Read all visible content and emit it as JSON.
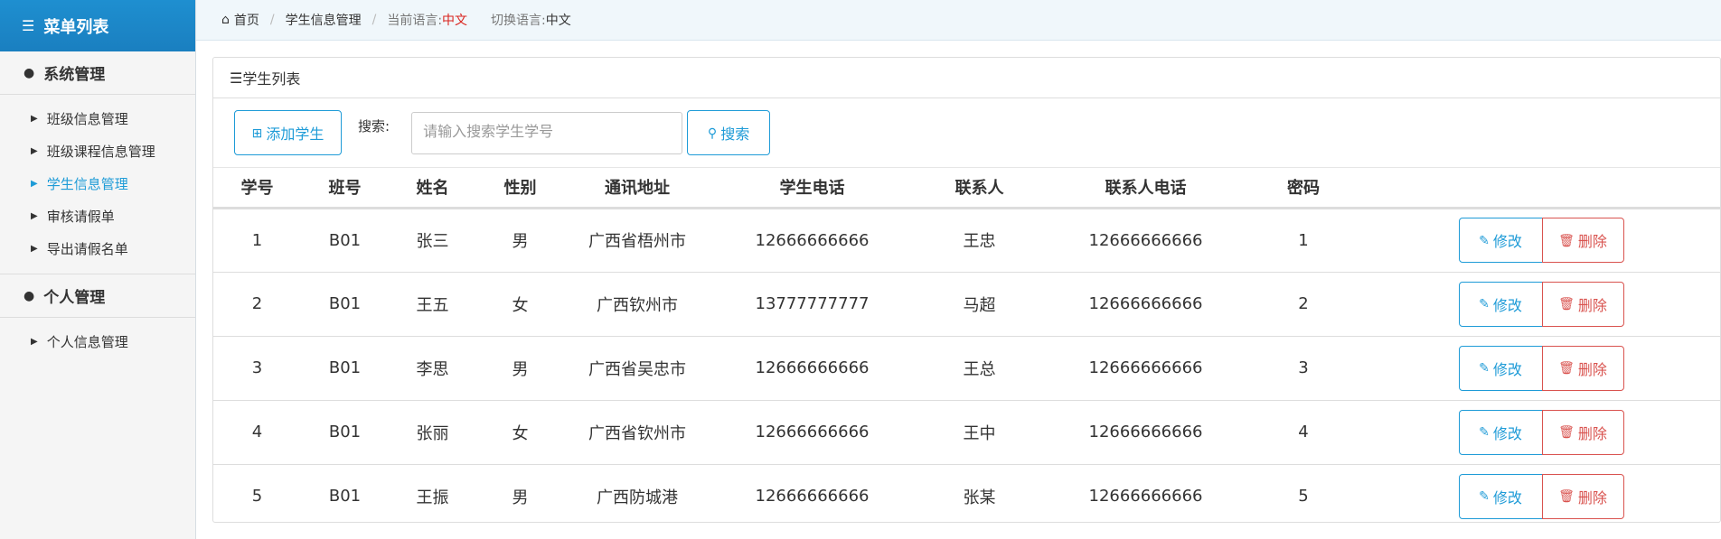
{
  "sidebar": {
    "title": "菜单列表",
    "groups": [
      {
        "title": "系统管理",
        "items": [
          "班级信息管理",
          "班级课程信息管理",
          "学生信息管理",
          "审核请假单",
          "导出请假名单"
        ]
      },
      {
        "title": "个人管理",
        "items": [
          "个人信息管理"
        ]
      }
    ],
    "active_item": "学生信息管理"
  },
  "breadcrumb": {
    "home": "首页",
    "current": "学生信息管理",
    "lang_label": "当前语言:",
    "lang_value": "中文",
    "switch_label": "切换语言:",
    "switch_value": "中文"
  },
  "panel": {
    "title": "学生列表",
    "add_button": "添加学生",
    "search_label": "搜索:",
    "search_placeholder": "请输入搜索学生学号",
    "search_button": "搜索"
  },
  "table": {
    "headers": [
      "学号",
      "班号",
      "姓名",
      "性别",
      "通讯地址",
      "学生电话",
      "联系人",
      "联系人电话",
      "密码"
    ],
    "rows": [
      [
        "1",
        "B01",
        "张三",
        "男",
        "广西省梧州市",
        "12666666666",
        "王忠",
        "12666666666",
        "1"
      ],
      [
        "2",
        "B01",
        "王五",
        "女",
        "广西钦州市",
        "13777777777",
        "马超",
        "12666666666",
        "2"
      ],
      [
        "3",
        "B01",
        "李思",
        "男",
        "广西省吴忠市",
        "12666666666",
        "王总",
        "12666666666",
        "3"
      ],
      [
        "4",
        "B01",
        "张丽",
        "女",
        "广西省钦州市",
        "12666666666",
        "王中",
        "12666666666",
        "4"
      ],
      [
        "5",
        "B01",
        "王振",
        "男",
        "广西防城港",
        "12666666666",
        "张某",
        "12666666666",
        "5"
      ]
    ],
    "edit_label": "修改",
    "delete_label": "删除"
  },
  "colors": {
    "accent": "#1e9bd7",
    "danger": "#d9534f",
    "lang_red": "#d9231d"
  }
}
